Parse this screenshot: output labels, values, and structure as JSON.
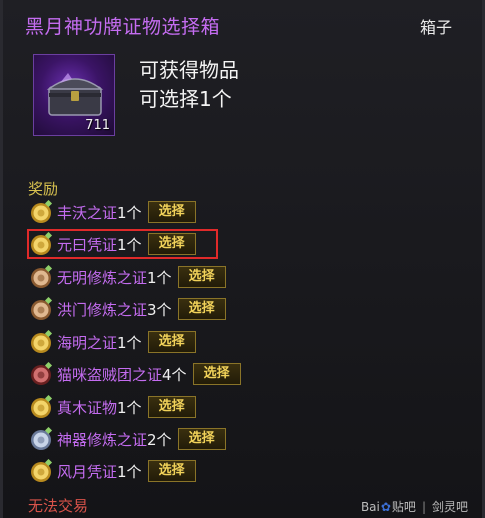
{
  "tooltip": {
    "title": "黑月神功牌证物选择箱",
    "category": "箱子",
    "item_count": "711",
    "obtain_line1": "可获得物品",
    "obtain_line2": "可选择1个",
    "reward_label": "奖励",
    "rewards": [
      {
        "name": "丰沃之证",
        "qty": "1个",
        "button": "选择",
        "icon": "gold-medal-icon"
      },
      {
        "name": "元曰凭证",
        "qty": "1个",
        "button": "选择",
        "icon": "gold-medal-icon"
      },
      {
        "name": "无明修炼之证",
        "qty": "1个",
        "button": "选择",
        "icon": "bronze-seal-icon"
      },
      {
        "name": "洪门修炼之证",
        "qty": "3个",
        "button": "选择",
        "icon": "bronze-seal-icon"
      },
      {
        "name": "海明之证",
        "qty": "1个",
        "button": "选择",
        "icon": "gold-medal-icon"
      },
      {
        "name": "猫咪盗贼团之证",
        "qty": "4个",
        "button": "选择",
        "icon": "red-seal-icon"
      },
      {
        "name": "真木证物",
        "qty": "1个",
        "button": "选择",
        "icon": "gold-medal-icon"
      },
      {
        "name": "神器修炼之证",
        "qty": "2个",
        "button": "选择",
        "icon": "silver-seal-icon"
      },
      {
        "name": "风月凭证",
        "qty": "1个",
        "button": "选择",
        "icon": "gold-medal-icon"
      }
    ],
    "footer": "无法交易"
  },
  "watermark": {
    "baidu": "Bai",
    "baidu2": "贴吧",
    "forum": "剑灵吧"
  },
  "colors": {
    "title": "#c46cf0",
    "button_text": "#f1d25a",
    "highlight": "#e02a2a",
    "footer": "#d9534a"
  }
}
